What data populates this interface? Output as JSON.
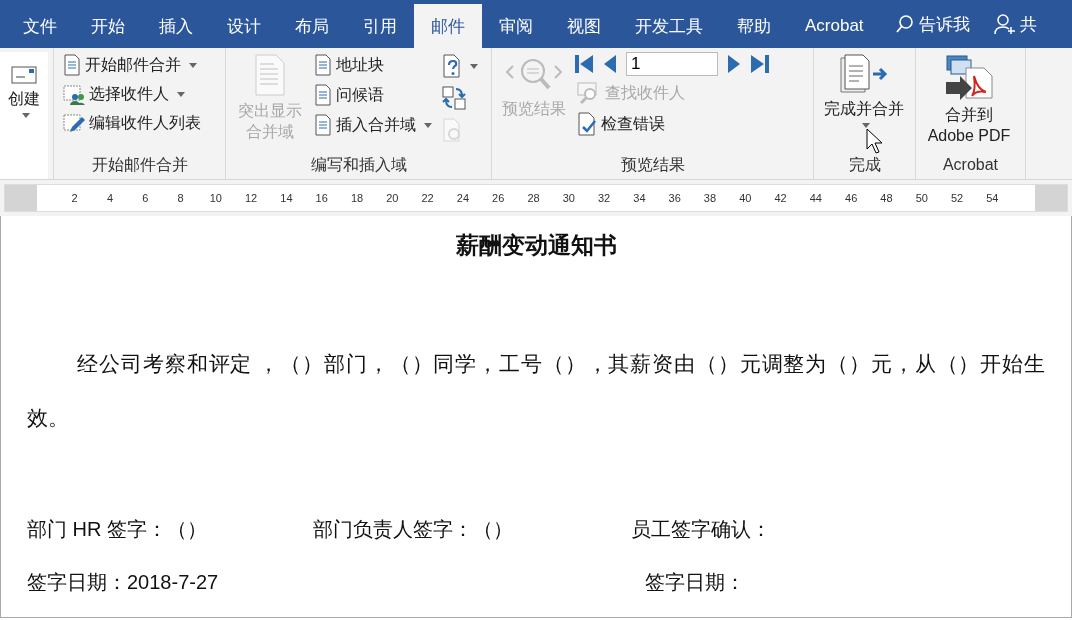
{
  "tabs": [
    {
      "label": "文件",
      "selected": false
    },
    {
      "label": "开始",
      "selected": false
    },
    {
      "label": "插入",
      "selected": false
    },
    {
      "label": "设计",
      "selected": false
    },
    {
      "label": "布局",
      "selected": false
    },
    {
      "label": "引用",
      "selected": false
    },
    {
      "label": "邮件",
      "selected": true
    },
    {
      "label": "审阅",
      "selected": false
    },
    {
      "label": "视图",
      "selected": false
    },
    {
      "label": "开发工具",
      "selected": false
    },
    {
      "label": "帮助",
      "selected": false
    },
    {
      "label": "Acrobat",
      "selected": false
    }
  ],
  "tell_me": {
    "label": "告诉我"
  },
  "share": {
    "label": "共"
  },
  "ribbon": [
    {
      "items": [
        {
          "kind": "large",
          "label": "创建",
          "disabled": false,
          "dropdown": true
        }
      ]
    },
    {
      "label": "开始邮件合并",
      "items": [
        {
          "kind": "small",
          "label": "开始邮件合并",
          "disabled": false,
          "dropdown": true
        },
        {
          "kind": "small",
          "label": "选择收件人",
          "disabled": false,
          "dropdown": true
        },
        {
          "kind": "small",
          "label": "编辑收件人列表",
          "disabled": false,
          "dropdown": false
        }
      ]
    },
    {
      "label": "编写和插入域",
      "items": [
        {
          "kind": "large",
          "label": "突出显示合并域",
          "disabled": true,
          "dropdown": false
        },
        {
          "kind": "small",
          "label": "地址块",
          "disabled": false,
          "dropdown": false
        },
        {
          "kind": "small",
          "label": "问候语",
          "disabled": false,
          "dropdown": false
        },
        {
          "kind": "small",
          "label": "插入合并域",
          "disabled": false,
          "dropdown": true
        },
        {
          "kind": "icon",
          "disabled": false,
          "dropdown": true
        },
        {
          "kind": "icon",
          "disabled": false,
          "dropdown": false
        },
        {
          "kind": "icon",
          "disabled": true,
          "dropdown": false
        }
      ]
    },
    {
      "label": "预览结果",
      "items": [
        {
          "kind": "large",
          "label": "预览结果",
          "disabled": true,
          "dropdown": false
        },
        {
          "kind": "nav",
          "value": "1"
        },
        {
          "kind": "small",
          "label": "查找收件人",
          "disabled": true,
          "dropdown": false
        },
        {
          "kind": "small",
          "label": "检查错误",
          "disabled": false,
          "dropdown": false
        }
      ]
    },
    {
      "label": "完成",
      "items": [
        {
          "kind": "large",
          "label": "完成并合并",
          "disabled": false,
          "dropdown": true
        }
      ]
    },
    {
      "label": "Acrobat",
      "items": [
        {
          "kind": "large",
          "label": "合并到 Adobe PDF",
          "disabled": false,
          "dropdown": false
        }
      ]
    }
  ],
  "ruler": [
    "2",
    "4",
    "6",
    "8",
    "10",
    "12",
    "14",
    "16",
    "18",
    "20",
    "22",
    "24",
    "26",
    "28",
    "30",
    "32",
    "34",
    "36",
    "38",
    "40",
    "42",
    "44",
    "46",
    "48",
    "50",
    "52",
    "54"
  ],
  "document": {
    "title": "薪酬变动通知书",
    "paragraph": "经公司考察和评定 ，（）部门，（）同学，工号（），其薪资由（）元调整为（）元，从（）开始生效。",
    "signature_rows": [
      [
        "部门 HR 签字：（）",
        "部门负责人签字：（）",
        "员工签字确认："
      ],
      [
        "签字日期：2018-7-27",
        "",
        "签字日期："
      ]
    ]
  }
}
